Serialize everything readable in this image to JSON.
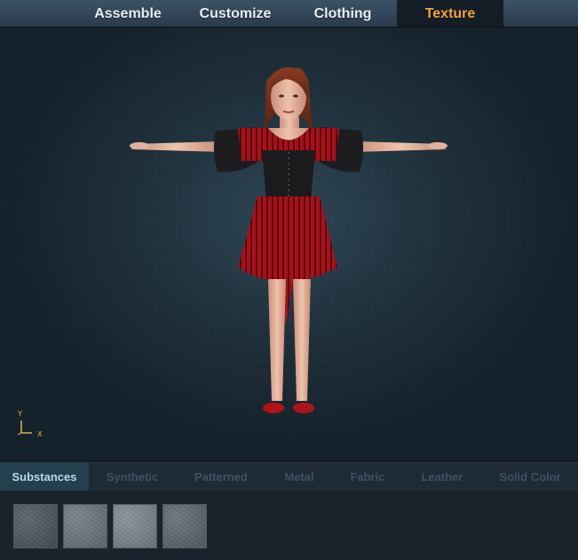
{
  "top_tabs": [
    {
      "label": "Assemble"
    },
    {
      "label": "Customize"
    },
    {
      "label": "Clothing"
    },
    {
      "label": "Texture",
      "active": true
    }
  ],
  "viewport": {
    "axis_labels": {
      "y": "Y",
      "x": "X"
    }
  },
  "sub_tabs": [
    {
      "label": "Substances",
      "active": true
    },
    {
      "label": "Synthetic"
    },
    {
      "label": "Patterned"
    },
    {
      "label": "Metal"
    },
    {
      "label": "Fabric"
    },
    {
      "label": "Leather"
    },
    {
      "label": "Solid Color"
    }
  ],
  "swatches": [
    {
      "name": "dark-grey-noise",
      "color": "#4a545b"
    },
    {
      "name": "grey-matte",
      "color": "#6b747b"
    },
    {
      "name": "satin-sheen",
      "color": "#7d868c"
    },
    {
      "name": "speckled-grey",
      "color": "#5e666c"
    }
  ],
  "colors": {
    "accent_active_tab": "#f2a53a",
    "active_subtab_text": "#b9d8ec",
    "dress_red": "#a8111a",
    "corset_black": "#1b1b1d"
  }
}
